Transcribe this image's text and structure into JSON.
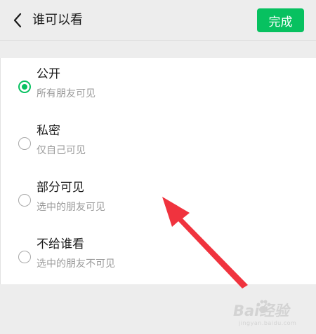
{
  "header": {
    "title": "谁可以看",
    "done_label": "完成"
  },
  "options": [
    {
      "title": "公开",
      "subtitle": "所有朋友可见",
      "selected": true
    },
    {
      "title": "私密",
      "subtitle": "仅自己可见",
      "selected": false
    },
    {
      "title": "部分可见",
      "subtitle": "选中的朋友可见",
      "selected": false
    },
    {
      "title": "不给谁看",
      "subtitle": "选中的朋友不可见",
      "selected": false
    }
  ],
  "watermark": {
    "text": "Bai经验",
    "sub": "jingyan.baidu.com"
  },
  "colors": {
    "accent": "#07c160",
    "annotation_arrow": "#f0333e",
    "background": "#ededed"
  },
  "icons": {
    "back": "chevron-left-icon",
    "paw": "paw-icon"
  }
}
